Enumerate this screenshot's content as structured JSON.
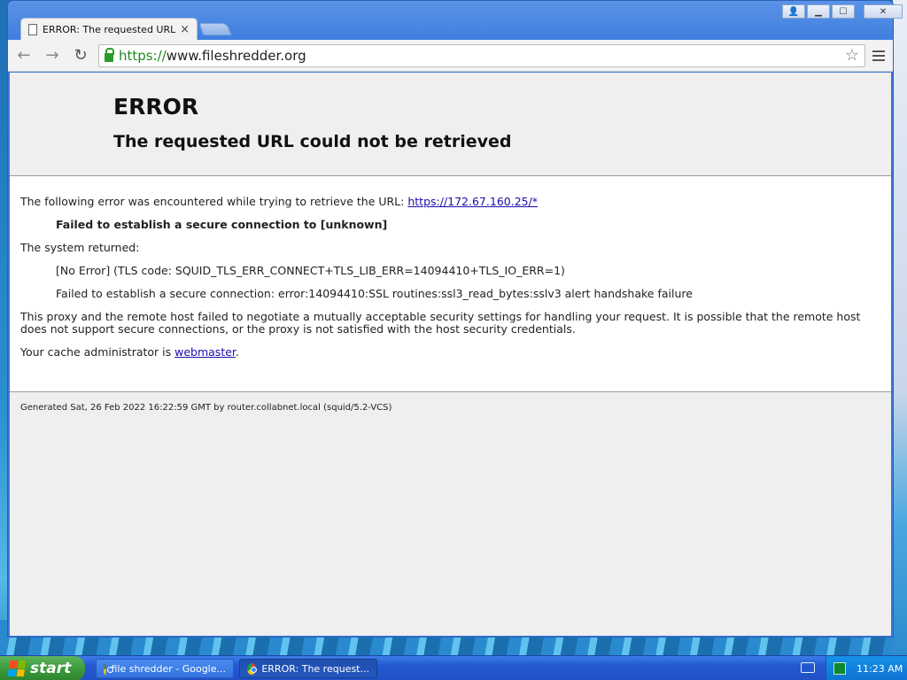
{
  "browser": {
    "tab_title": "ERROR: The requested URL",
    "tab_close": "×",
    "url_scheme": "https://",
    "url_rest": "www.fileshredder.org",
    "back_glyph": "←",
    "forward_glyph": "→",
    "reload_glyph": "↻",
    "star_glyph": "☆"
  },
  "window_buttons": {
    "profile": "👤",
    "minimize": "▁",
    "maximize": "☐",
    "close": "✕"
  },
  "page": {
    "heading": "ERROR",
    "subheading": "The requested URL could not be retrieved",
    "intro_text": "The following error was encountered while trying to retrieve the URL: ",
    "intro_link": "https://172.67.160.25/*",
    "failed_secure": "Failed to establish a secure connection to [unknown]",
    "system_returned": "The system returned:",
    "no_error": "[No Error] (TLS code: SQUID_TLS_ERR_CONNECT+TLS_LIB_ERR=14094410+TLS_IO_ERR=1)",
    "handshake": "Failed to establish a secure connection: error:14094410:SSL routines:ssl3_read_bytes:sslv3 alert handshake failure",
    "explanation": "This proxy and the remote host failed to negotiate a mutually acceptable security settings for handling your request. It is possible that the remote host does not support secure connections, or the proxy is not satisfied with the host security credentials.",
    "admin_text": "Your cache administrator is ",
    "admin_link": "webmaster",
    "admin_period": ".",
    "footer": "Generated Sat, 26 Feb 2022 16:22:59 GMT by router.collabnet.local (squid/5.2-VCS)"
  },
  "taskbar": {
    "start_label": "start",
    "items": [
      {
        "label": "file shredder - Google..."
      },
      {
        "label": "ERROR: The request..."
      }
    ],
    "clock": "11:23 AM"
  }
}
